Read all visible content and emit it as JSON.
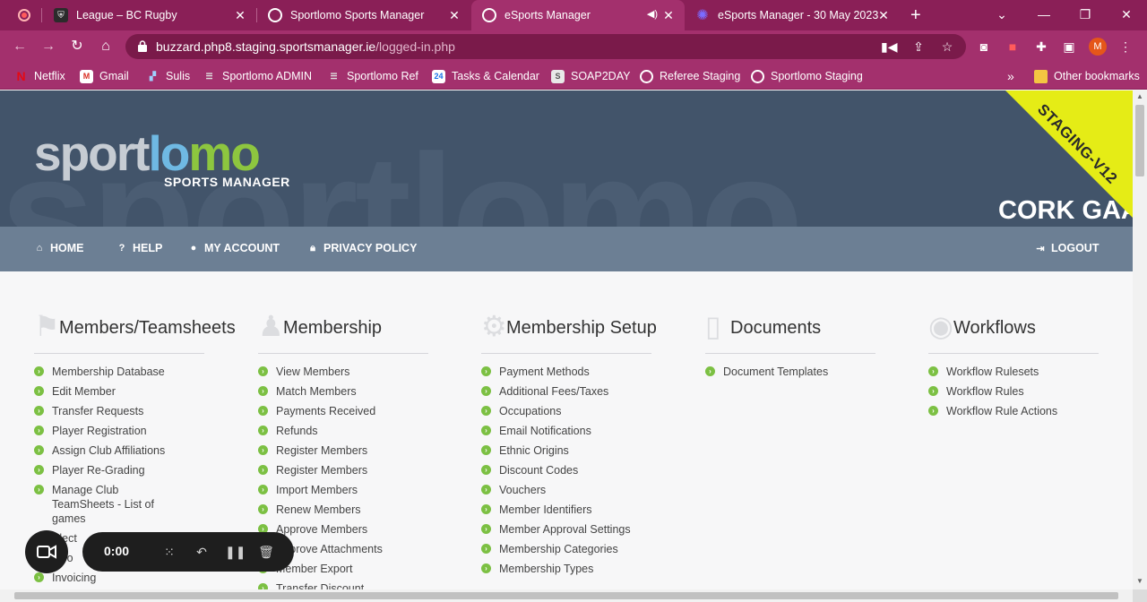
{
  "browser": {
    "tabs": [
      {
        "title": "League – BC Rugby",
        "icon": "rugby-shield-icon"
      },
      {
        "title": "Sportlomo Sports Manager",
        "icon": "globe-icon"
      },
      {
        "title": "eSports Manager",
        "icon": "globe-icon",
        "active": true
      },
      {
        "title": "eSports Manager - 30 May 2023",
        "icon": "sportlomo-star-icon"
      }
    ],
    "url_host": "buzzard.php8.staging.sportsmanager.ie",
    "url_path": "/logged-in.php",
    "profile_initial": "M",
    "bookmarks": [
      {
        "label": "Netflix"
      },
      {
        "label": "Gmail"
      },
      {
        "label": "Sulis"
      },
      {
        "label": "Sportlomo ADMIN"
      },
      {
        "label": "Sportlomo Ref"
      },
      {
        "label": "Tasks & Calendar"
      },
      {
        "label": "SOAP2DAY"
      },
      {
        "label": "Referee Staging"
      },
      {
        "label": "Sportlomo Staging"
      }
    ],
    "overflow_label": "»",
    "other_bookmarks": "Other bookmarks",
    "accent": "#a3306d"
  },
  "header": {
    "logo_part1": "sport",
    "logo_part2": "lo",
    "logo_part3": "mo",
    "logo_subtitle": "SPORTS MANAGER",
    "watermark": "sportlomo",
    "club_name": "CORK GAA",
    "ribbon": "STAGING-V12"
  },
  "nav": {
    "home": "HOME",
    "help": "HELP",
    "account": "MY ACCOUNT",
    "privacy": "PRIVACY POLICY",
    "logout": "LOGOUT"
  },
  "sections": [
    {
      "title": "Members/Teamsheets",
      "icon": "flag-icon",
      "items": [
        "Membership Database",
        "Edit Member",
        "Transfer Requests",
        "Player Registration",
        "Assign Club Affiliations",
        "Player Re-Grading",
        "Manage Club TeamSheets - List of games",
        "Elect",
        "Invo",
        "Invoicing"
      ]
    },
    {
      "title": "Membership",
      "icon": "users-icon",
      "items": [
        "View Members",
        "Match Members",
        "Payments Received",
        "Refunds",
        "Register Members",
        "Register Members",
        "Import Members",
        "Renew Members",
        "Approve Members",
        "Approve Attachments",
        "Member Export",
        "Transfer Discount"
      ]
    },
    {
      "title": "Membership Setup",
      "icon": "gears-icon",
      "items": [
        "Payment Methods",
        "Additional Fees/Taxes",
        "Occupations",
        "Email Notifications",
        "Ethnic Origins",
        "Discount Codes",
        "Vouchers",
        "Member Identifiers",
        "Member Approval Settings",
        "Membership Categories",
        "Membership Types"
      ]
    },
    {
      "title": "Documents",
      "icon": "document-icon",
      "items": [
        "Document Templates"
      ]
    },
    {
      "title": "Workflows",
      "icon": "palette-icon",
      "items": [
        "Workflow Rulesets",
        "Workflow Rules",
        "Workflow Rule Actions"
      ]
    }
  ],
  "recorder": {
    "time": "0:00"
  }
}
